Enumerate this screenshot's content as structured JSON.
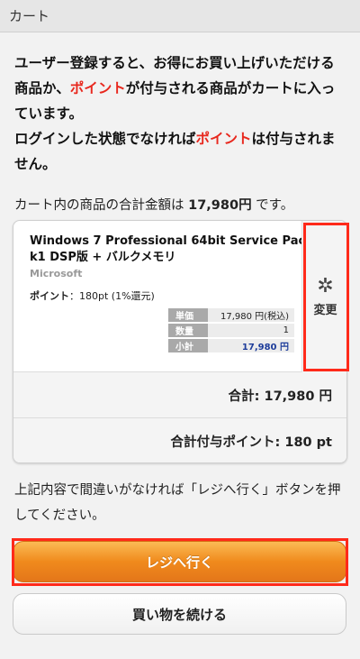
{
  "header": {
    "title": "カート"
  },
  "notice": {
    "part1": "ユーザー登録すると、お得にお買い上げいただける商品か、",
    "point_word_1": "ポイント",
    "part2": "が付与される商品がカートに入っています。",
    "part3": "ログインした状態でなければ",
    "point_word_2": "ポイント",
    "part4": "は付与されません。"
  },
  "cart_total": {
    "prefix": "カート内の商品の合計金額は ",
    "amount": "17,980円",
    "suffix": " です。"
  },
  "item": {
    "title": "Windows 7 Professional 64bit Service Pack1 DSP版 + バルクメモリ",
    "maker": "Microsoft",
    "points_label": "ポイント",
    "points_value": "：180pt (1%還元)",
    "price_rows": [
      {
        "label": "単価",
        "value": "17,980 円(税込)"
      },
      {
        "label": "数量",
        "value": "1"
      },
      {
        "label": "小計",
        "value": "17,980 円"
      }
    ],
    "change_label": "変更",
    "change_icon": "gear-icon"
  },
  "summary": {
    "total": "合計: 17,980 円",
    "points_total": "合計付与ポイント: 180 pt"
  },
  "guide_text": "上記内容で間違いがなければ「レジへ行く」ボタンを押してください。",
  "buttons": {
    "checkout": "レジへ行く",
    "continue": "買い物を続ける"
  },
  "colors": {
    "accent_red": "#e8281e",
    "highlight": "#ff2a1a",
    "checkout_orange": "#f08a1c",
    "subtotal_blue": "#1d3c9a"
  }
}
